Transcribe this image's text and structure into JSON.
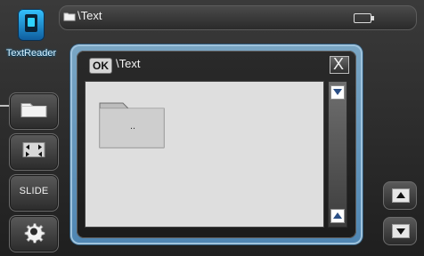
{
  "app": {
    "name": "TextReader",
    "icon": "text-reader-icon"
  },
  "top_bar": {
    "path": "\\Text",
    "folder_icon": "folder-icon",
    "battery_icon": "battery-icon"
  },
  "sidebar": {
    "buttons": [
      {
        "label": "",
        "icon": "folder-icon"
      },
      {
        "label": "",
        "icon": "fit-screen-icon"
      },
      {
        "label": "SLIDE",
        "icon": ""
      },
      {
        "label": "",
        "icon": "gear-icon"
      }
    ]
  },
  "dialog": {
    "ok_label": "OK",
    "path": "\\Text",
    "close_label": "X",
    "items": [
      {
        "label": "..",
        "icon": "folder-icon"
      }
    ]
  },
  "right_controls": {
    "up_icon": "page-up-icon",
    "down_icon": "page-down-icon"
  },
  "colors": {
    "accent": "#4f86b3",
    "screen_bg": "#2b2b2b",
    "content_bg": "#dedede"
  }
}
